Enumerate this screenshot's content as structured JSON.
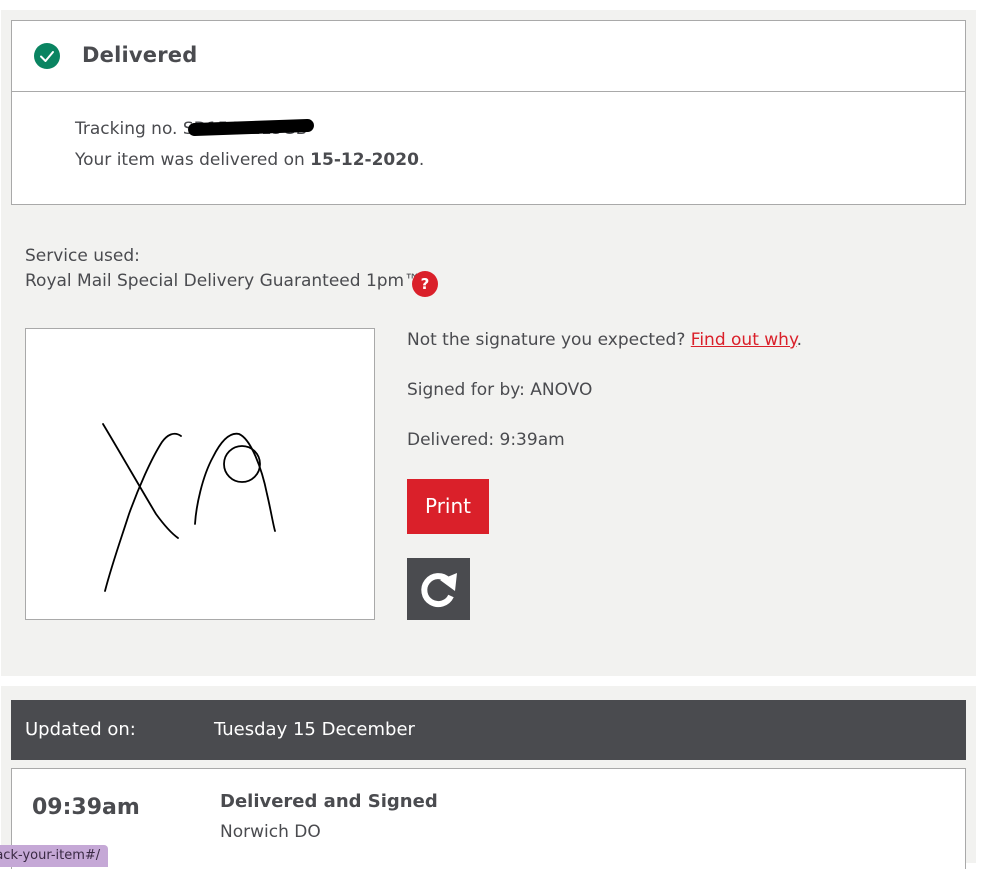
{
  "status": {
    "title": "Delivered",
    "icon": "check-circle-icon",
    "accent_color": "#0a8461"
  },
  "tracking": {
    "prefix": "Tracking no.",
    "visible_number": "SD1541115GB",
    "delivered_text": "Your item was delivered on ",
    "delivered_date": "15-12-2020",
    "delivered_suffix": "."
  },
  "service": {
    "label": "Service used:",
    "name": "Royal Mail Special Delivery Guaranteed 1pm™",
    "help_icon": "?"
  },
  "signature": {
    "question": "Not the signature you expected?",
    "link_text": "Find out why",
    "link_suffix": ".",
    "signed_for": "Signed for by: ANOVO",
    "delivered_time": "Delivered: 9:39am",
    "print_label": "Print",
    "rotate_icon": "rotate-icon"
  },
  "history": {
    "updated_label": "Updated on:",
    "updated_date": "Tuesday 15 December",
    "events": [
      {
        "time": "09:39am",
        "title": "Delivered and Signed",
        "location": "Norwich DO"
      }
    ]
  },
  "status_bar": {
    "url": "rack-your-item#/"
  },
  "colors": {
    "brand_red": "#da202a",
    "dark_grey": "#4a4b4f",
    "panel_bg": "#f2f2f0"
  }
}
